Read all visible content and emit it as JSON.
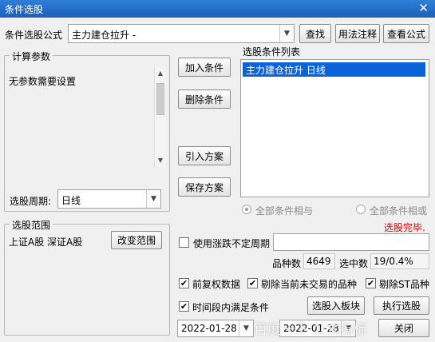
{
  "window": {
    "title": "条件选股",
    "close_glyph": "✕"
  },
  "formula": {
    "label": "条件选股公式",
    "value": "主力建仓拉升 -",
    "find_label": "查找",
    "usage_label": "用法注释",
    "view_label": "查看公式"
  },
  "params": {
    "legend": "计算参数",
    "message": "无参数需要设置",
    "period_label": "选股周期:",
    "period_value": "日线"
  },
  "actions": {
    "add": "加入条件",
    "remove": "删除条件",
    "import": "引入方案",
    "save": "保存方案"
  },
  "conditions": {
    "label": "选股条件列表",
    "items": [
      "主力建仓拉升  日线"
    ],
    "radio_and": "全部条件相与",
    "radio_or": "全部条件相或",
    "status": "选股完毕.",
    "status_color": "#e00000"
  },
  "range": {
    "legend": "选股范围",
    "value": "上证A股 深证A股",
    "change_label": "改变范围"
  },
  "options": {
    "use_cycle_label": "使用涨跌不定周期",
    "count_label": "品种数",
    "count_value": "4649",
    "hit_label": "选中数",
    "hit_value": "19/0.4%",
    "fq_label": "前复权数据",
    "exclude_untraded_label": "剔除当前未交易的品种",
    "exclude_st_label": "剔除ST品种",
    "timespan_label": "时间段内满足条件",
    "check_glyph": "✔"
  },
  "bottom": {
    "add_block_label": "选股入板块",
    "execute_label": "执行选股",
    "close_label": "关闭",
    "start_date": "2022-01-28",
    "end_date": "2022-01-28",
    "watermark": "百度一下 公式指标"
  }
}
